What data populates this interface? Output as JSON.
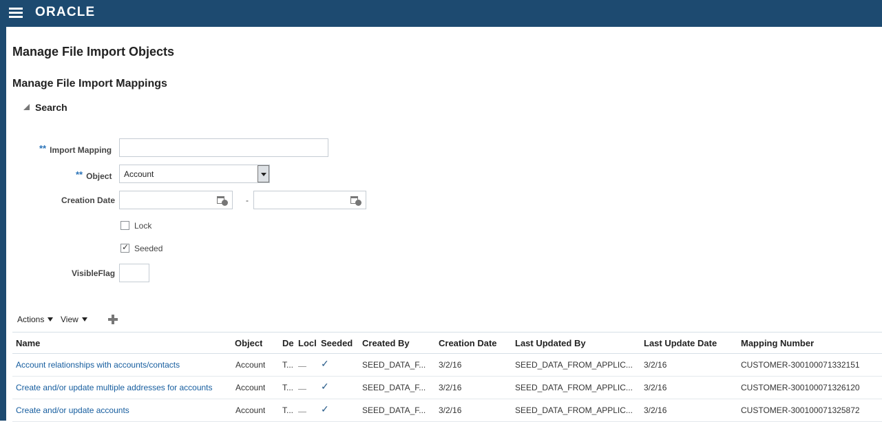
{
  "brand": "ORACLE",
  "page": {
    "title": "Manage File Import Objects",
    "subtitle": "Manage File Import Mappings"
  },
  "search": {
    "toggle_label": "Search",
    "required_marker": "**",
    "import_mapping_label": "Import Mapping",
    "import_mapping_value": "",
    "object_label": "Object",
    "object_value": "Account",
    "creation_date_label": "Creation Date",
    "date_range_separator": "-",
    "creation_date_from": "",
    "creation_date_to": "",
    "lock_label": "Lock",
    "lock_checked": false,
    "seeded_label": "Seeded",
    "seeded_checked": true,
    "visible_flag_label": "VisibleFlag",
    "visible_flag_value": ""
  },
  "toolbar": {
    "actions_label": "Actions",
    "view_label": "View",
    "add_icon": "plus-icon"
  },
  "table": {
    "columns": [
      "Name",
      "Object",
      "De",
      "Locl",
      "Seeded",
      "Created By",
      "Creation Date",
      "Last Updated By",
      "Last Update Date",
      "Mapping Number"
    ],
    "rows": [
      {
        "name": "Account relationships with accounts/contacts",
        "object": "Account",
        "description": "T...",
        "seeded_mark": "✓",
        "created_by": "SEED_DATA_F...",
        "creation_date": "3/2/16",
        "last_updated_by": "SEED_DATA_FROM_APPLIC...",
        "last_update_date": "3/2/16",
        "mapping_number": "CUSTOMER-300100071332151"
      },
      {
        "name": "Create and/or update multiple addresses for accounts",
        "object": "Account",
        "description": "T...",
        "seeded_mark": "✓",
        "created_by": "SEED_DATA_F...",
        "creation_date": "3/2/16",
        "last_updated_by": "SEED_DATA_FROM_APPLIC...",
        "last_update_date": "3/2/16",
        "mapping_number": "CUSTOMER-300100071326120"
      },
      {
        "name": "Create and/or update accounts",
        "object": "Account",
        "description": "T...",
        "seeded_mark": "✓",
        "created_by": "SEED_DATA_F...",
        "creation_date": "3/2/16",
        "last_updated_by": "SEED_DATA_FROM_APPLIC...",
        "last_update_date": "3/2/16",
        "mapping_number": "CUSTOMER-300100071325872"
      }
    ]
  },
  "colors": {
    "header_bar": "#1d4a70",
    "link": "#145c9e",
    "required": "#2a73b8"
  }
}
